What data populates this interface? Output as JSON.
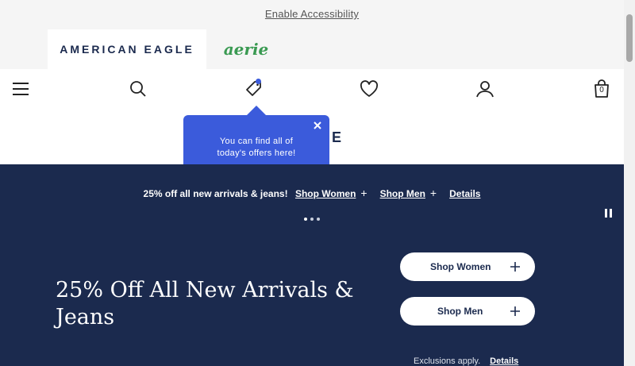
{
  "accessibility": {
    "link_label": "Enable Accessibility"
  },
  "brand_tabs": {
    "american_eagle": "AMERICAN EAGLE",
    "aerie": "aerie"
  },
  "nav_icons": {
    "menu": "hamburger-menu-icon",
    "search": "search-icon",
    "offers": "offer-tag-icon",
    "favorites": "heart-icon",
    "account": "user-icon",
    "bag": "shopping-bag-icon",
    "bag_count": "0"
  },
  "logo": {
    "text": "EAGLE"
  },
  "tooltip": {
    "text": "You can find all of today's offers here!",
    "close_icon": "close-icon"
  },
  "promo_banner": {
    "text": "25% off all new arrivals & jeans!",
    "shop_women": "Shop Women",
    "shop_men": "Shop Men",
    "details": "Details",
    "slide_count": 3,
    "active_slide": 1
  },
  "hero": {
    "headline": "25% Off All New Arrivals & Jeans",
    "cta_women": "Shop Women",
    "cta_men": "Shop Men",
    "exclusions": "Exclusions apply.",
    "details": "Details"
  },
  "colors": {
    "navy": "#1b2a4e",
    "tooltip_blue": "#3b5bdb",
    "aerie_green": "#3a9a52",
    "top_bg": "#f5f5f5"
  }
}
